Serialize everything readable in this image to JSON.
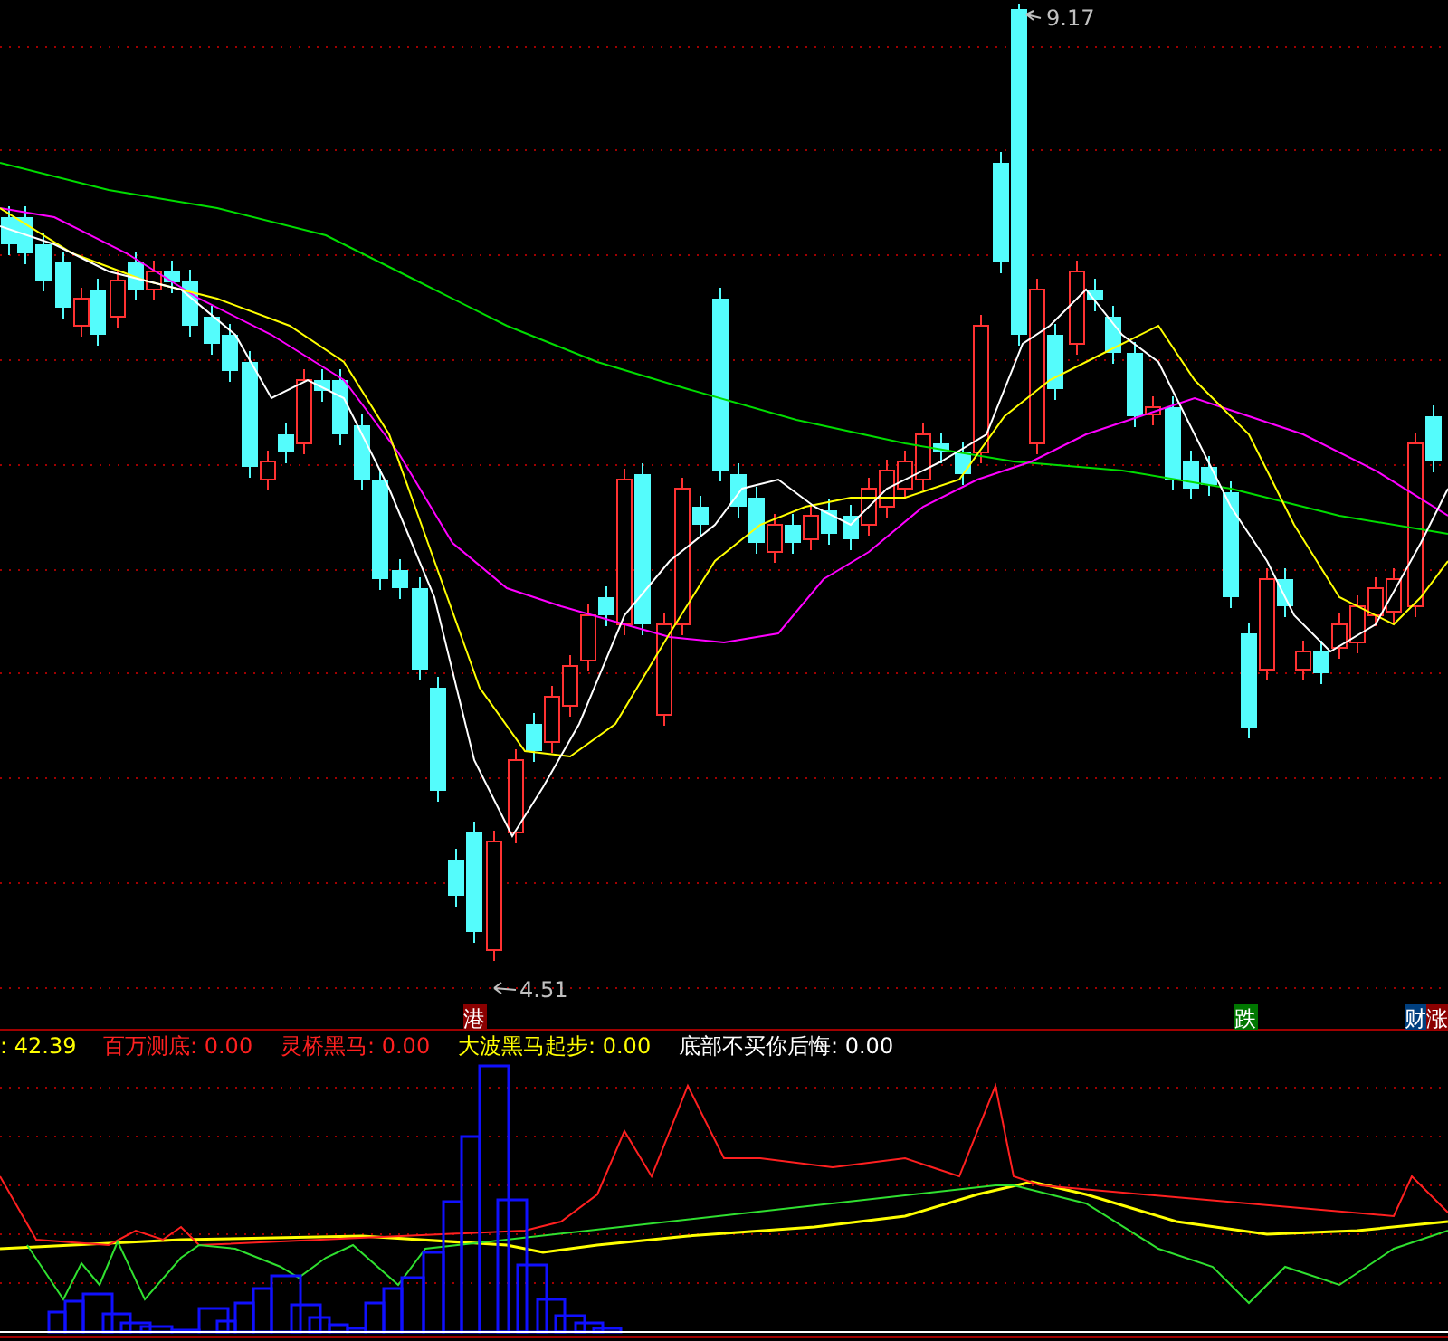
{
  "price_chart": {
    "high_label": "9.17",
    "low_label": "4.51"
  },
  "markers": [
    {
      "label": "港",
      "color": "#8b0000"
    },
    {
      "label": "跌",
      "color": "#007700"
    },
    {
      "label": "财",
      "color": "#003f7f"
    },
    {
      "label": "涨",
      "color": "#8b0000"
    }
  ],
  "indicator_legend": [
    {
      "text": ": 42.39",
      "color": "#ffff00"
    },
    {
      "text": "百万测底: 0.00",
      "color": "#ff2020"
    },
    {
      "text": "灵桥黑马: 0.00",
      "color": "#ff2020"
    },
    {
      "text": "大波黑马起步: 0.00",
      "color": "#ffff00"
    },
    {
      "text": "底部不买你后悔: 0.00",
      "color": "#ffffff"
    }
  ]
}
